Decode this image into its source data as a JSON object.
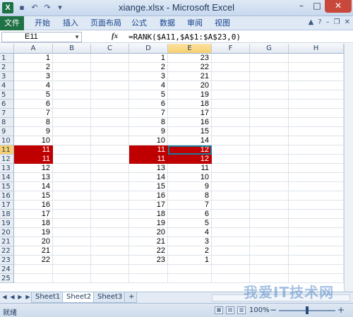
{
  "window": {
    "title": "xiange.xlsx - Microsoft Excel"
  },
  "ribbon_tabs": [
    "文件",
    "开始",
    "插入",
    "页面布局",
    "公式",
    "数据",
    "审阅",
    "视图"
  ],
  "formula_bar": {
    "name_box": "E11",
    "fx_label": "fx",
    "formula": "=RANK($A11,$A$1:$A$23,0)"
  },
  "columns": [
    "A",
    "B",
    "C",
    "D",
    "E",
    "F",
    "G",
    "H"
  ],
  "rows": [
    {
      "num": "1",
      "A": "1",
      "D": "1",
      "E": "23"
    },
    {
      "num": "2",
      "A": "2",
      "D": "2",
      "E": "22"
    },
    {
      "num": "3",
      "A": "3",
      "D": "3",
      "E": "21"
    },
    {
      "num": "4",
      "A": "4",
      "D": "4",
      "E": "20"
    },
    {
      "num": "5",
      "A": "5",
      "D": "5",
      "E": "19"
    },
    {
      "num": "6",
      "A": "6",
      "D": "6",
      "E": "18"
    },
    {
      "num": "7",
      "A": "7",
      "D": "7",
      "E": "17"
    },
    {
      "num": "8",
      "A": "8",
      "D": "8",
      "E": "16"
    },
    {
      "num": "9",
      "A": "9",
      "D": "9",
      "E": "15"
    },
    {
      "num": "10",
      "A": "10",
      "D": "10",
      "E": "14"
    },
    {
      "num": "11",
      "A": "11",
      "D": "11",
      "E": "12",
      "highlight": true
    },
    {
      "num": "12",
      "A": "11",
      "D": "11",
      "E": "12",
      "highlight": true
    },
    {
      "num": "13",
      "A": "12",
      "D": "13",
      "E": "11"
    },
    {
      "num": "14",
      "A": "13",
      "D": "14",
      "E": "10"
    },
    {
      "num": "15",
      "A": "14",
      "D": "15",
      "E": "9"
    },
    {
      "num": "16",
      "A": "15",
      "D": "16",
      "E": "8"
    },
    {
      "num": "17",
      "A": "16",
      "D": "17",
      "E": "7"
    },
    {
      "num": "18",
      "A": "17",
      "D": "18",
      "E": "6"
    },
    {
      "num": "19",
      "A": "18",
      "D": "19",
      "E": "5"
    },
    {
      "num": "20",
      "A": "19",
      "D": "20",
      "E": "4"
    },
    {
      "num": "21",
      "A": "20",
      "D": "21",
      "E": "3"
    },
    {
      "num": "22",
      "A": "21",
      "D": "22",
      "E": "2"
    },
    {
      "num": "23",
      "A": "22",
      "D": "23",
      "E": "1"
    },
    {
      "num": "24",
      "A": "",
      "D": "",
      "E": ""
    },
    {
      "num": "25",
      "A": "",
      "D": "",
      "E": ""
    }
  ],
  "sheets": [
    "Sheet1",
    "Sheet2",
    "Sheet3"
  ],
  "active_sheet": "Sheet2",
  "status": {
    "ready": "就绪",
    "zoom": "100%"
  },
  "watermark": "我爱IT技术网",
  "colors": {
    "highlight": "#c00000",
    "file_tab": "#1f7244",
    "active_border": "#1a7c9a"
  }
}
